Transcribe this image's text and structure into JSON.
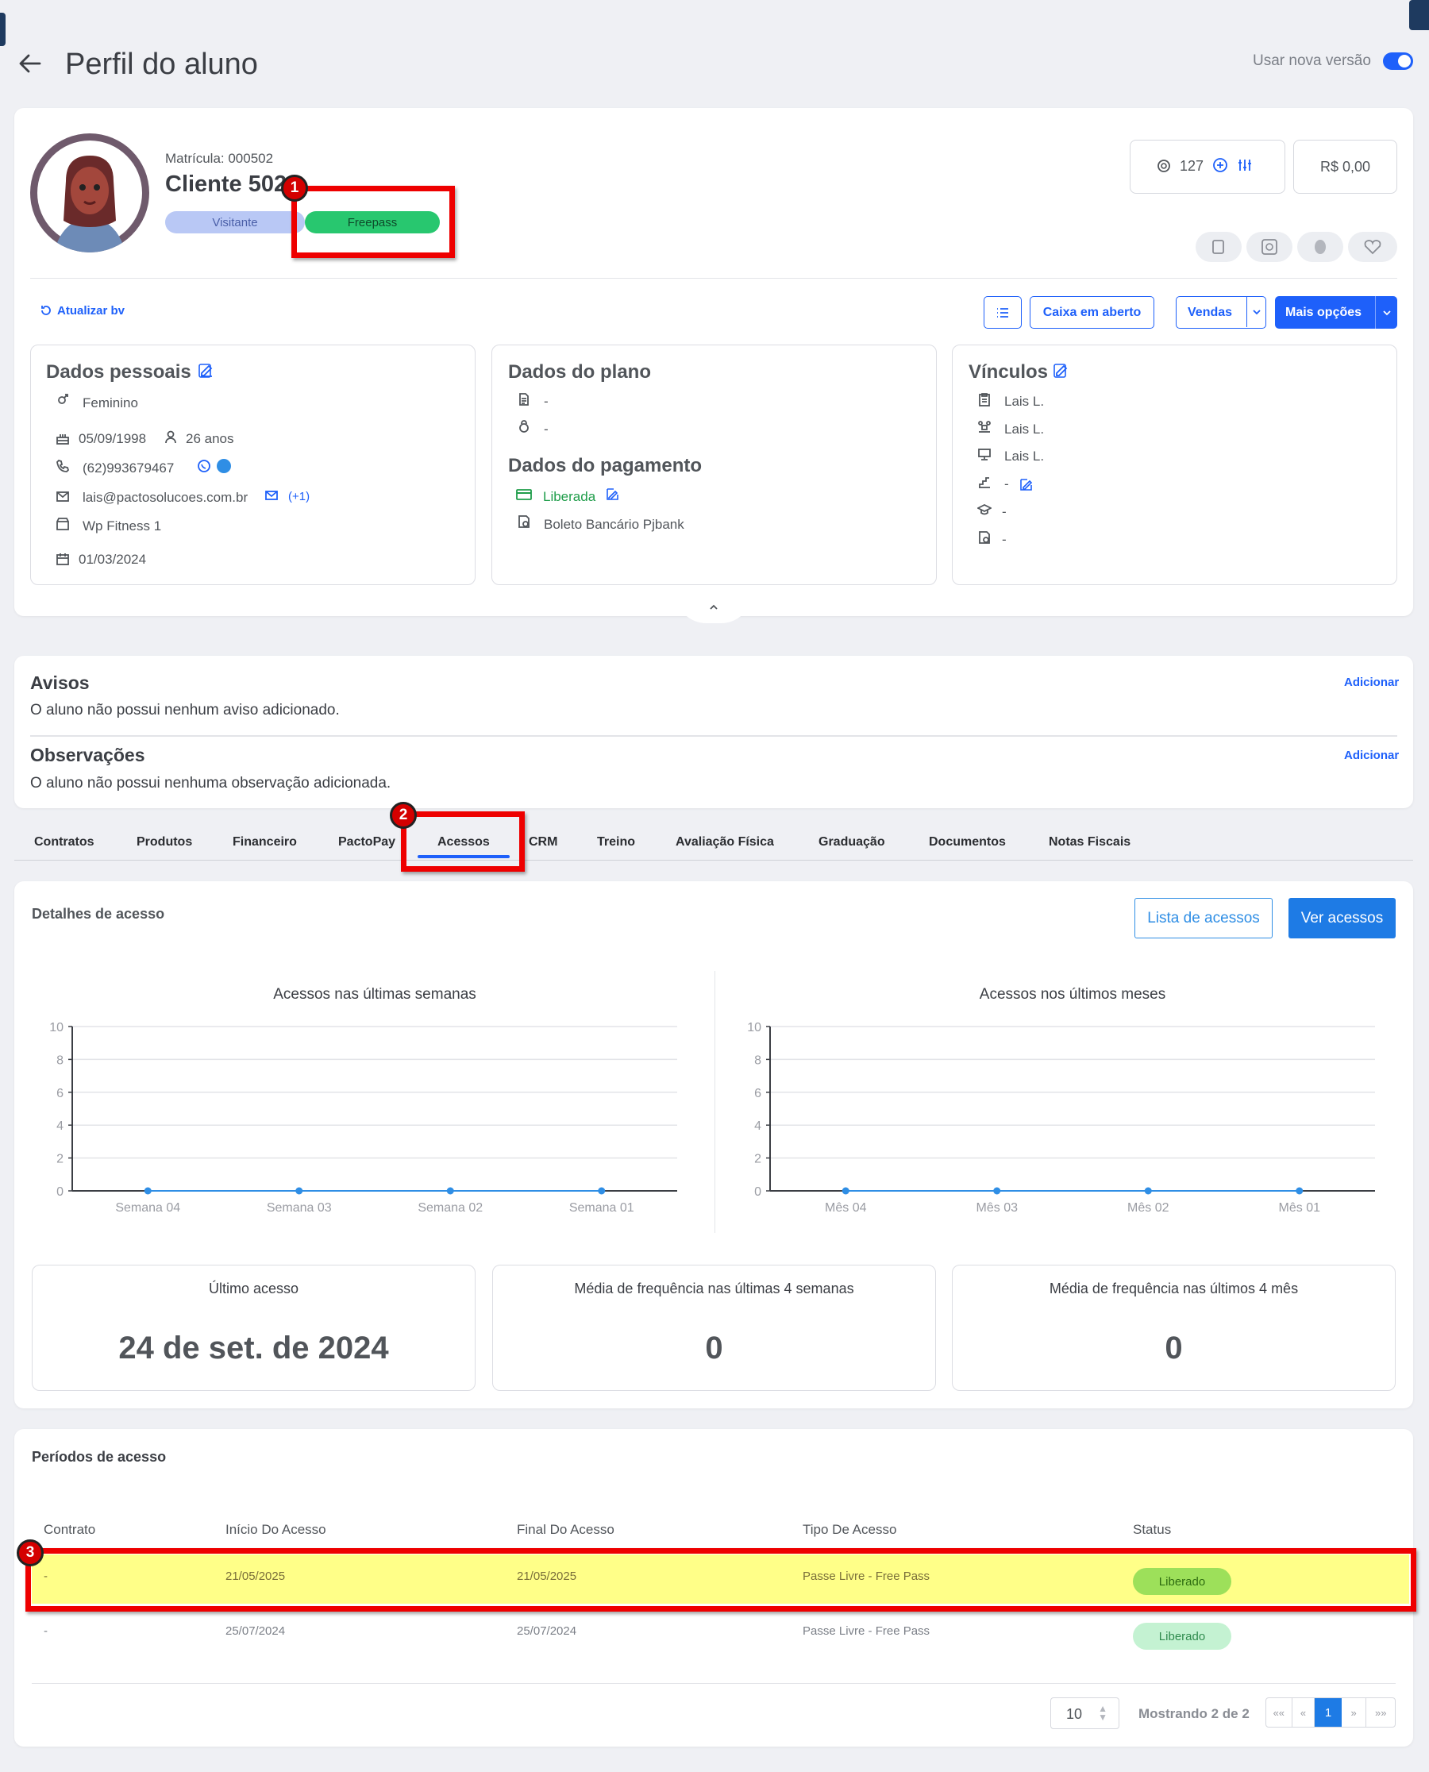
{
  "header": {
    "title": "Perfil do aluno",
    "toggle_label": "Usar nova versão"
  },
  "profile": {
    "matricula": "Matrícula: 000502",
    "name": "Cliente 502",
    "badge_visitante": "Visitante",
    "badge_freepass": "Freepass",
    "points": "127",
    "balance": "R$ 0,00",
    "refresh": "Atualizar bv"
  },
  "actions": {
    "caixa": "Caixa em aberto",
    "vendas": "Vendas",
    "mais": "Mais opções"
  },
  "dados_pessoais": {
    "title": "Dados pessoais",
    "gender": "Feminino",
    "birth": "05/09/1998",
    "age": "26 anos",
    "phone": "(62)993679467",
    "email": "lais@pactosolucoes.com.br",
    "email_extra": "(+1)",
    "gym": "Wp Fitness 1",
    "date": "01/03/2024"
  },
  "dados_plano": {
    "title": "Dados do plano",
    "plan": "-",
    "plan2": "-",
    "pay_title": "Dados do pagamento",
    "status": "Liberada",
    "method": "Boleto Bancário Pjbank"
  },
  "vinculos": {
    "title": "Vínculos",
    "v1": "Lais L.",
    "v2": "Lais L.",
    "v3": "Lais L.",
    "v4": "-",
    "v5": "-",
    "v6": "-"
  },
  "avisos": {
    "title": "Avisos",
    "text": "O aluno não possui nenhum aviso adicionado.",
    "add": "Adicionar"
  },
  "observacoes": {
    "title": "Observações",
    "text": "O aluno não possui nenhuma observação adicionada.",
    "add": "Adicionar"
  },
  "tabs": [
    "Contratos",
    "Produtos",
    "Financeiro",
    "PactoPay",
    "Acessos",
    "CRM",
    "Treino",
    "Avaliação Física",
    "Graduação",
    "Documentos",
    "Notas Fiscais"
  ],
  "acesso": {
    "title": "Detalhes de acesso",
    "lista": "Lista de acessos",
    "ver": "Ver acessos"
  },
  "chart_data": [
    {
      "type": "line",
      "title": "Acessos nas últimas semanas",
      "categories": [
        "Semana 04",
        "Semana 03",
        "Semana 02",
        "Semana 01"
      ],
      "values": [
        0,
        0,
        0,
        0
      ],
      "ylim": [
        0,
        10
      ],
      "yticks": [
        0,
        2,
        4,
        6,
        8,
        10
      ],
      "color": "#2f8ee5"
    },
    {
      "type": "line",
      "title": "Acessos nos últimos meses",
      "categories": [
        "Mês 04",
        "Mês 03",
        "Mês 02",
        "Mês 01"
      ],
      "values": [
        0,
        0,
        0,
        0
      ],
      "ylim": [
        0,
        10
      ],
      "yticks": [
        0,
        2,
        4,
        6,
        8,
        10
      ],
      "color": "#2f8ee5"
    }
  ],
  "stats": [
    {
      "label": "Último acesso",
      "value": "24 de set. de 2024"
    },
    {
      "label": "Média de frequência nas últimas 4 semanas",
      "value": "0"
    },
    {
      "label": "Média de frequência nas últimos 4 mês",
      "value": "0"
    }
  ],
  "periodos": {
    "title": "Períodos de acesso",
    "columns": [
      "Contrato",
      "Início Do Acesso",
      "Final Do Acesso",
      "Tipo De Acesso",
      "Status"
    ],
    "rows": [
      [
        "-",
        "21/05/2025",
        "21/05/2025",
        "Passe Livre - Free Pass",
        "Liberado"
      ],
      [
        "-",
        "25/07/2024",
        "25/07/2024",
        "Passe Livre - Free Pass",
        "Liberado"
      ]
    ]
  },
  "pagination": {
    "per_page": "10",
    "showing": "Mostrando 2 de 2",
    "first": "««",
    "prev": "«",
    "page": "1",
    "next": "»",
    "last": "»»"
  },
  "markers": [
    "1",
    "2",
    "3"
  ],
  "colors": {
    "accent": "#1e60fa",
    "green": "#22c55e",
    "highlight": "#ffff88",
    "red": "#e00000"
  }
}
